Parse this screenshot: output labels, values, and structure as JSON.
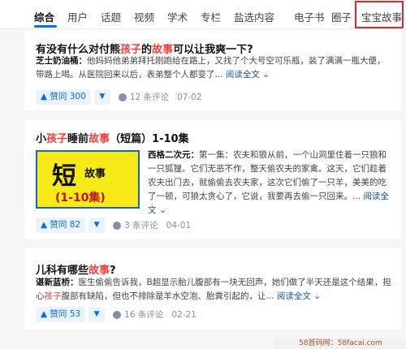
{
  "tabs": [
    {
      "label": "综合",
      "active": true
    },
    {
      "label": "用户"
    },
    {
      "label": "话题"
    },
    {
      "label": "视频"
    },
    {
      "label": "学术"
    },
    {
      "label": "专栏"
    },
    {
      "label": "盐选内容"
    },
    {
      "label": "电子书"
    },
    {
      "label": "圈子"
    },
    {
      "label": "宝宝故事",
      "highlighted": true
    }
  ],
  "results": [
    {
      "title_parts": [
        "有没有什么对付熊",
        "孩子",
        "的",
        "故事",
        "可以让我爽一下?"
      ],
      "author": "芝士奶油桶：",
      "excerpt": "他妈妈他弟弟拜托刚跑给在路上，又找了个大号空可乐瓶，装了满满一瓶大便，带路上喝。从医院回来以后，表弟整个人都变了...",
      "read_more": "阅读全文",
      "votes": "▲ 赞同 300",
      "comments": "12 条评论",
      "date": "07-02"
    },
    {
      "title_parts": [
        "小",
        "孩子",
        "睡前",
        "故事",
        "（短篇）1-10集"
      ],
      "thumb": {
        "big": "短",
        "small": "故事",
        "red": "(1-10集)"
      },
      "author": "西格二次元：",
      "excerpt": "第一集：农夫和狼从前，一个山洞里住着一只狼和一只狐狸。它们无恶不作，整天偷农夫的家禽。这天，它们趁着农夫出门去，就偷偷去农夫家，这次它们偷了一只羊，美美的吃了一顿，可狼太贪心了，它说，我要再去偷一只回来。...",
      "read_more": "阅读全文",
      "votes": "▲ 赞同 82",
      "comments": "3 条评论",
      "date": "04-01"
    },
    {
      "title_parts": [
        "儿科有哪些",
        "故事",
        "?"
      ],
      "author": "谌新蓝桥：",
      "excerpt_parts": [
        "医生偷偷告诉我，B超显示胎儿腹部有一块无回声，她们做了半天还是这个结果，担心",
        "孩子",
        "腹部有缺陷，但也不排除是羊水空泡、胎粪引起的，让..."
      ],
      "read_more": "阅读全文",
      "votes": "▲ 赞同 53",
      "comments": "16 条评论",
      "date": "02-21"
    }
  ],
  "icons": {
    "vote_down": "▼",
    "comment": "comment-bubble-icon",
    "chevron": "⌄"
  },
  "colors": {
    "accent": "#056de8",
    "highlight_text": "#f1403c",
    "highlight_box": "#e3262c"
  },
  "watermark": "58首码网：58facai.com"
}
